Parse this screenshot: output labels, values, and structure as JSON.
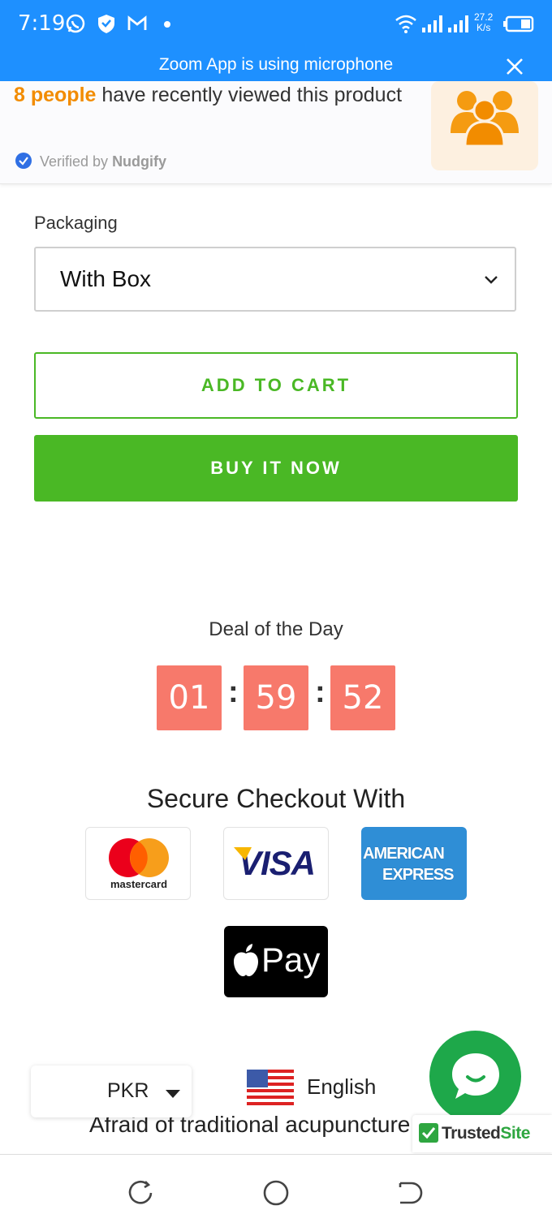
{
  "status_bar": {
    "time": "7:19",
    "net_speed_value": "27.2",
    "net_speed_unit": "K/s",
    "icons": [
      "whatsapp-icon",
      "shield-icon",
      "gmail-icon",
      "dot-icon",
      "wifi-icon",
      "signal-icon",
      "signal-icon",
      "battery-icon"
    ]
  },
  "notification": {
    "text": "Zoom App is using microphone"
  },
  "nudge": {
    "count": "8 people",
    "rest": " have recently viewed this product",
    "verified_prefix": "Verified by ",
    "verified_brand": "Nudgify"
  },
  "packaging": {
    "label": "Packaging",
    "selected": "With Box"
  },
  "buttons": {
    "add_to_cart": "ADD TO CART",
    "buy_now": "BUY IT NOW"
  },
  "deal": {
    "title": "Deal of the Day",
    "hours": "01",
    "minutes": "59",
    "seconds": "52",
    "separator": ":"
  },
  "checkout": {
    "title": "Secure Checkout With",
    "mastercard_label": "mastercard",
    "visa_label": "VISA",
    "amex_line1": "AMERICAN",
    "amex_line2": "EXPRESS",
    "applepay_label": "Pay"
  },
  "footer": {
    "currency": "PKR",
    "language": "English",
    "teaser_text": "Afraid of traditional acupuncture",
    "trusted_part1": "Trusted",
    "trusted_part2": "Site"
  },
  "colors": {
    "status_bar": "#1e90ff",
    "accent_green": "#4ab825",
    "countdown": "#f7796b",
    "nudge_orange": "#f28c00",
    "chat_green": "#1ea84a"
  }
}
